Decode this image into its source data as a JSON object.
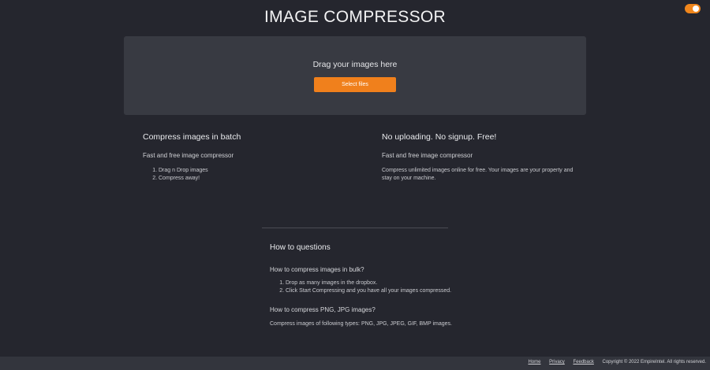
{
  "header": {
    "title": "IMAGE COMPRESSOR",
    "theme_toggle": {
      "state": "on",
      "color": "#f0861c"
    }
  },
  "dropzone": {
    "prompt": "Drag your images here",
    "button_label": "Select files"
  },
  "features": {
    "left": {
      "title": "Compress images in batch",
      "subtitle": "Fast and free image compressor",
      "steps": [
        "Drag n Drop images",
        "Compress away!"
      ]
    },
    "right": {
      "title": "No uploading. No signup. Free!",
      "subtitle": "Fast and free image compressor",
      "text": "Compress unlimited images online for free. Your images are your property and stay on your machine."
    }
  },
  "faq": {
    "title": "How to questions",
    "items": [
      {
        "question": "How to compress images in bulk?",
        "steps": [
          "Drop as many images in the dropbox.",
          "Click Start Compressing and you have all your images compressed."
        ]
      },
      {
        "question": "How to compress PNG, JPG images?",
        "answer": "Compress images of following types: PNG, JPG, JPEG, GIF, BMP images."
      }
    ]
  },
  "footer": {
    "links": [
      "Home",
      "Privacy",
      "Feedback"
    ],
    "copyright": "Copyright © 2022 EmpireIntel. All rights reserved."
  },
  "colors": {
    "background": "#25262e",
    "panel": "#383a42",
    "accent": "#f0801c",
    "footer": "#33353d"
  }
}
